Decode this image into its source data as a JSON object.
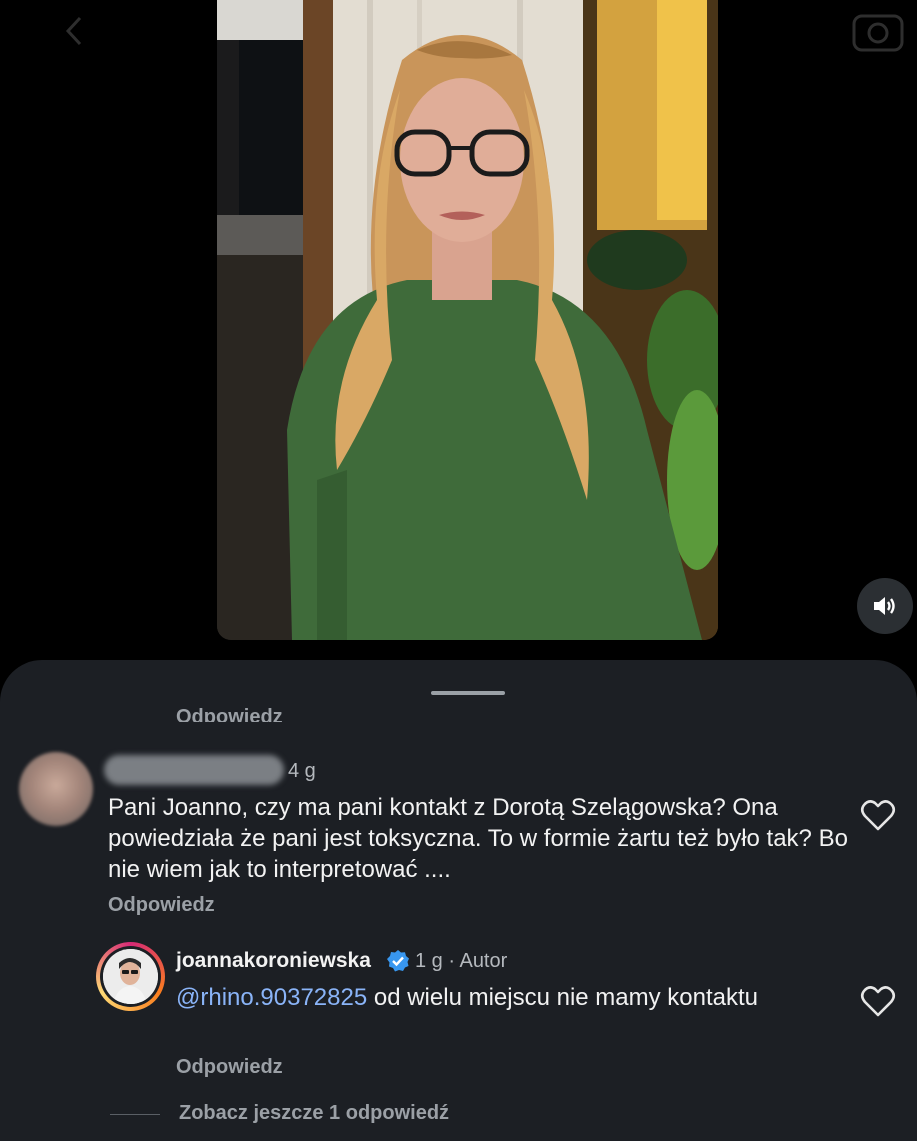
{
  "video": {
    "icons": {
      "sound": "speaker-icon",
      "back": "chevron-left-icon",
      "camera": "camera-icon"
    }
  },
  "comments": {
    "partial_reply_label": "Odpowiedz",
    "comment1": {
      "time": "4 g",
      "text": "Pani Joanno, czy ma pani kontakt z Dorotą Szelągowska? Ona powiedziała że pani jest toksyczna. To w formie żartu też było tak? Bo nie wiem jak to interpretować ....",
      "reply_label": "Odpowiedz",
      "like_icon": "heart-icon"
    },
    "reply1": {
      "username": "joannakoroniewska",
      "meta": "1 g · Autor",
      "mention": "@rhino.90372825",
      "text": " od wielu miejscu nie mamy kontaktu",
      "reply_label": "Odpowiedz",
      "like_icon": "heart-icon",
      "badge_icon": "verified-badge-icon"
    },
    "view_more": "Zobacz jeszcze 1 odpowiedź"
  },
  "colors": {
    "sheet_bg": "#1c1f24",
    "mention": "#8ab4f8",
    "muted": "#9ba0a6",
    "verified": "#3897f0"
  }
}
